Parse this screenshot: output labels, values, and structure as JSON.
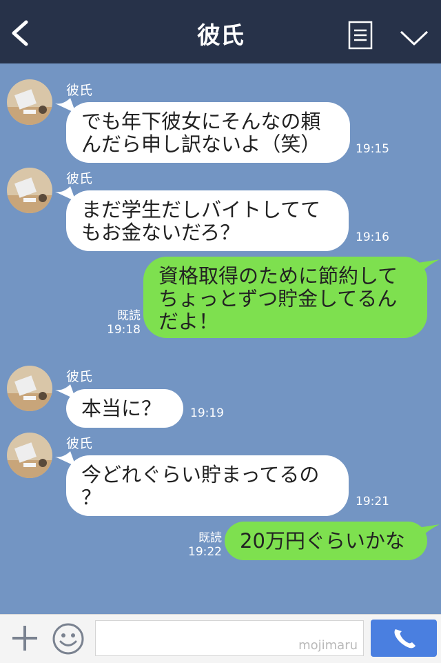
{
  "header": {
    "title": "彼氏"
  },
  "messages": [
    {
      "sender": "彼氏",
      "text_lines": [
        "でも年下彼女にそんなの頼",
        "んだら申し訳ないよ（笑）"
      ],
      "time": "19:15"
    },
    {
      "sender": "彼氏",
      "text_lines": [
        "まだ学生だしバイトしてて",
        "もお金ないだろ？"
      ],
      "time": "19:16"
    },
    {
      "text_lines": [
        "資格取得のために節約して",
        "ちょっとずつ貯金してるん",
        "だよ！"
      ],
      "read": "既読",
      "time": "19:18"
    },
    {
      "sender": "彼氏",
      "text_lines": [
        "本当に？"
      ],
      "time": "19:19"
    },
    {
      "sender": "彼氏",
      "text_lines": [
        "今どれぐらい貯まってるの",
        "？"
      ],
      "time": "19:21"
    },
    {
      "text_lines": [
        "20万円ぐらいかな"
      ],
      "read": "既読",
      "time": "19:22"
    }
  ],
  "footer": {
    "watermark": "mojimaru"
  },
  "colors": {
    "header": "#273249",
    "chat_bg": "#7395c3",
    "outgoing": "#7ee04f",
    "incoming": "#ffffff",
    "call": "#4a7fe0"
  }
}
